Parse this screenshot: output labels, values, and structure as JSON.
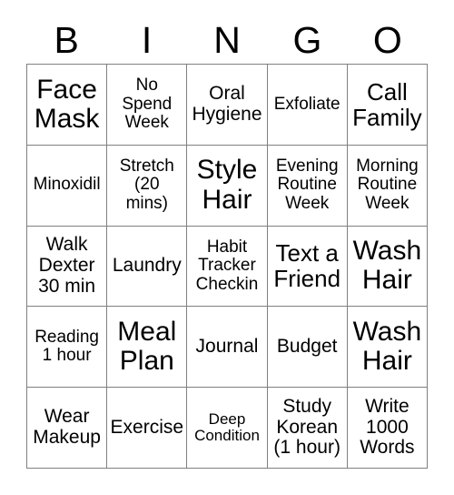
{
  "card": {
    "title": "BINGO Card",
    "header_letters": [
      "B",
      "I",
      "N",
      "G",
      "O"
    ],
    "columns": 5,
    "rows": 5,
    "background_color": "#ffffff",
    "text_color": "#000000",
    "grid_line_color": "#808080"
  },
  "cells": [
    {
      "text": "Face\nMask",
      "size": "xl"
    },
    {
      "text": "No\nSpend\nWeek",
      "size": "sm"
    },
    {
      "text": "Oral\nHygiene",
      "size": "md"
    },
    {
      "text": "Exfoliate",
      "size": "sm"
    },
    {
      "text": "Call\nFamily",
      "size": "lg"
    },
    {
      "text": "Minoxidil",
      "size": "sm"
    },
    {
      "text": "Stretch\n(20\nmins)",
      "size": "sm"
    },
    {
      "text": "Style\nHair",
      "size": "xl"
    },
    {
      "text": "Evening\nRoutine\nWeek",
      "size": "sm"
    },
    {
      "text": "Morning\nRoutine\nWeek",
      "size": "sm"
    },
    {
      "text": "Walk\nDexter\n30 min",
      "size": "md"
    },
    {
      "text": "Laundry",
      "size": "md"
    },
    {
      "text": "Habit\nTracker\nCheckin",
      "size": "sm"
    },
    {
      "text": "Text a\nFriend",
      "size": "lg"
    },
    {
      "text": "Wash\nHair",
      "size": "xl"
    },
    {
      "text": "Reading\n1 hour",
      "size": "sm"
    },
    {
      "text": "Meal\nPlan",
      "size": "xl"
    },
    {
      "text": "Journal",
      "size": "md"
    },
    {
      "text": "Budget",
      "size": "md"
    },
    {
      "text": "Wash\nHair",
      "size": "xl"
    },
    {
      "text": "Wear\nMakeup",
      "size": "md"
    },
    {
      "text": "Exercise",
      "size": "md"
    },
    {
      "text": "Deep\nCondition",
      "size": "xs"
    },
    {
      "text": "Study\nKorean\n(1 hour)",
      "size": "md"
    },
    {
      "text": "Write\n1000\nWords",
      "size": "md"
    }
  ]
}
